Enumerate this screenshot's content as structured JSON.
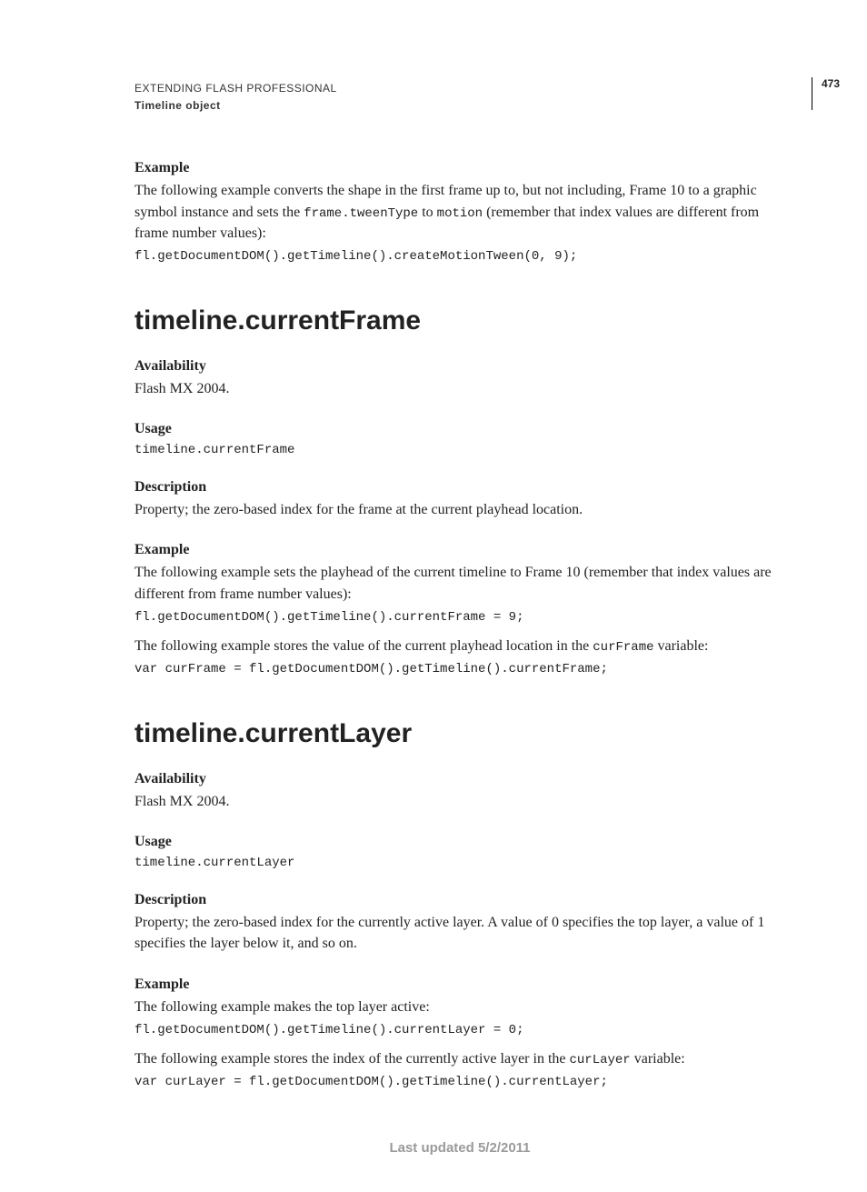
{
  "header": {
    "chapter": "EXTENDING FLASH PROFESSIONAL",
    "section": "Timeline object",
    "page_number": "473"
  },
  "intro": {
    "example_heading": "Example",
    "example_text_1": "The following example converts the shape in the first frame up to, but not including, Frame 10 to a graphic symbol instance and sets the ",
    "example_code_a": "frame.tweenType",
    "example_text_mid": " to ",
    "example_code_b": "motion",
    "example_text_2": " (remember that index values are different from frame number values):",
    "code": "fl.getDocumentDOM().getTimeline().createMotionTween(0, 9);"
  },
  "section1": {
    "title": "timeline.currentFrame",
    "avail_heading": "Availability",
    "avail_text": "Flash MX 2004.",
    "usage_heading": "Usage",
    "usage_code": "timeline.currentFrame",
    "desc_heading": "Description",
    "desc_text": "Property; the zero-based index for the frame at the current playhead location.",
    "example_heading": "Example",
    "example_text1": "The following example sets the playhead of the current timeline to Frame 10 (remember that index values are different from frame number values):",
    "code1": "fl.getDocumentDOM().getTimeline().currentFrame = 9;",
    "example_text2_a": "The following example stores the value of the current playhead location in the ",
    "example_text2_code": "curFrame",
    "example_text2_b": " variable:",
    "code2": "var curFrame = fl.getDocumentDOM().getTimeline().currentFrame;"
  },
  "section2": {
    "title": "timeline.currentLayer",
    "avail_heading": "Availability",
    "avail_text": "Flash MX 2004.",
    "usage_heading": "Usage",
    "usage_code": "timeline.currentLayer",
    "desc_heading": "Description",
    "desc_text": "Property; the zero-based index for the currently active layer. A value of 0 specifies the top layer, a value of 1 specifies the layer below it, and so on.",
    "example_heading": "Example",
    "example_text1": "The following example makes the top layer active:",
    "code1": "fl.getDocumentDOM().getTimeline().currentLayer = 0;",
    "example_text2_a": "The following example stores the index of the currently active layer in the ",
    "example_text2_code": "curLayer",
    "example_text2_b": " variable:",
    "code2": "var curLayer = fl.getDocumentDOM().getTimeline().currentLayer;"
  },
  "footer": "Last updated 5/2/2011"
}
